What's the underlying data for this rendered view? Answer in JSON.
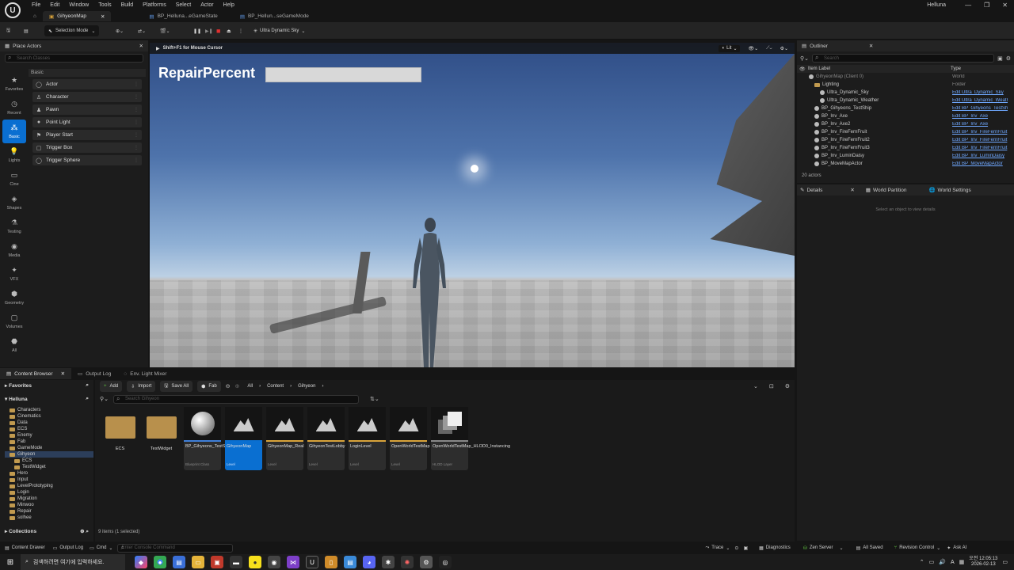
{
  "window": {
    "user": "Helluna",
    "controls": [
      "—",
      "❐",
      "✕"
    ]
  },
  "menu": [
    "File",
    "Edit",
    "Window",
    "Tools",
    "Build",
    "Platforms",
    "Select",
    "Actor",
    "Help"
  ],
  "tabs": [
    {
      "label": "GihyeonMap",
      "active": true
    },
    {
      "label": "BP_Helluna...eGameState",
      "active": false
    },
    {
      "label": "BP_Hellun...seGameMode",
      "active": false
    }
  ],
  "toolbar": {
    "mode": "Selection Mode",
    "sky": "Ultra Dynamic Sky"
  },
  "place_actors": {
    "title": "Place Actors",
    "search_placeholder": "Search Classes",
    "section": "Basic",
    "categories": [
      "Favorites",
      "Recent",
      "Basic",
      "Lights",
      "Cine",
      "Shapes",
      "Testing",
      "Media",
      "VFX",
      "Geometry",
      "Volumes",
      "All"
    ],
    "items": [
      "Actor",
      "Character",
      "Pawn",
      "Point Light",
      "Player Start",
      "Trigger Box",
      "Trigger Sphere"
    ]
  },
  "viewport": {
    "hint": "Shift+F1 for Mouse Cursor",
    "lit": "Lit",
    "overlay_text": "RepairPercent",
    "repair_percent": 0
  },
  "outliner": {
    "title": "Outliner",
    "search_placeholder": "Search",
    "col_label": "Item Label",
    "col_type": "Type",
    "rows": [
      {
        "label": "GihyeonMap (Client 0)",
        "type": "World",
        "indent": 1,
        "link": false
      },
      {
        "label": "Lighting",
        "type": "Folder",
        "indent": 2,
        "link": false
      },
      {
        "label": "Ultra_Dynamic_Sky",
        "type": "Edit Ultra_Dynamic_Sky",
        "indent": 3,
        "link": true
      },
      {
        "label": "Ultra_Dynamic_Weather",
        "type": "Edit Ultra_Dynamic_Weather",
        "indent": 3,
        "link": true
      },
      {
        "label": "BP_Gihyeons_TestShip",
        "type": "Edit BP_Gihyeons_TestShip",
        "indent": 2,
        "link": true
      },
      {
        "label": "BP_Inv_Axe",
        "type": "Edit BP_Inv_Axe",
        "indent": 2,
        "link": true
      },
      {
        "label": "BP_Inv_Axe2",
        "type": "Edit BP_Inv_Axe",
        "indent": 2,
        "link": true
      },
      {
        "label": "BP_Inv_FireFernFruit",
        "type": "Edit BP_Inv_FireFernFruit",
        "indent": 2,
        "link": true
      },
      {
        "label": "BP_Inv_FireFernFruit2",
        "type": "Edit BP_Inv_FireFernFruit",
        "indent": 2,
        "link": true
      },
      {
        "label": "BP_Inv_FireFernFruit3",
        "type": "Edit BP_Inv_FireFernFruit",
        "indent": 2,
        "link": true
      },
      {
        "label": "BP_Inv_LuminDaisy",
        "type": "Edit BP_Inv_LuminDaisy",
        "indent": 2,
        "link": true
      },
      {
        "label": "BP_MoveMapActor",
        "type": "Edit BP_MoveMapActor",
        "indent": 2,
        "link": true
      }
    ],
    "count": "20 actors"
  },
  "details": {
    "tabs": [
      "Details",
      "World Partition",
      "World Settings"
    ],
    "empty": "Select an object to view details"
  },
  "bottom_tabs": [
    "Content Browser",
    "Output Log",
    "Env. Light Mixer"
  ],
  "content_browser": {
    "favorites": "Favorites",
    "root": "Helluna",
    "tree": [
      {
        "label": "Characters",
        "indent": 1
      },
      {
        "label": "Cinematics",
        "indent": 1
      },
      {
        "label": "Data",
        "indent": 1
      },
      {
        "label": "ECS",
        "indent": 1
      },
      {
        "label": "Enemy",
        "indent": 1
      },
      {
        "label": "Fab",
        "indent": 1
      },
      {
        "label": "GameMode",
        "indent": 1
      },
      {
        "label": "Gihyeon",
        "indent": 1,
        "selected": true
      },
      {
        "label": "ECS",
        "indent": 2
      },
      {
        "label": "TestWidget",
        "indent": 2
      },
      {
        "label": "Hero",
        "indent": 1
      },
      {
        "label": "Input",
        "indent": 1
      },
      {
        "label": "LevelPrototyping",
        "indent": 1
      },
      {
        "label": "Login",
        "indent": 1
      },
      {
        "label": "Migration",
        "indent": 1
      },
      {
        "label": "Minwoo",
        "indent": 1
      },
      {
        "label": "Repair",
        "indent": 1
      },
      {
        "label": "solhee",
        "indent": 1
      }
    ],
    "collections": "Collections",
    "add": "Add",
    "import": "Import",
    "save_all": "Save All",
    "fab": "Fab",
    "path": [
      "All",
      "Content",
      "Gihyeon"
    ],
    "search_placeholder": "Search Gihyeon",
    "assets": [
      {
        "name": "ECS",
        "type": "",
        "kind": "folder"
      },
      {
        "name": "TestWidget",
        "type": "",
        "kind": "folder"
      },
      {
        "name": "BP_Gihyeons_TestShip",
        "type": "Blueprint Class",
        "kind": "sphere"
      },
      {
        "name": "GihyeonMap",
        "type": "Level",
        "kind": "level",
        "selected": true
      },
      {
        "name": "GihyeonMap_Real",
        "type": "Level",
        "kind": "level"
      },
      {
        "name": "GihyeonTestLobby",
        "type": "Level",
        "kind": "level"
      },
      {
        "name": "LoginLevel",
        "type": "Level",
        "kind": "level"
      },
      {
        "name": "OpenWorldTestMap",
        "type": "Level",
        "kind": "level"
      },
      {
        "name": "OpenWorldTestMap_HLOD0_Instancing",
        "type": "HLOD Layer",
        "kind": "hlod"
      }
    ],
    "status": "9 items (1 selected)"
  },
  "statusbar": {
    "content_drawer": "Content Drawer",
    "output_log": "Output Log",
    "cmd": "Cmd",
    "cmd_placeholder": "Enter Console Command",
    "trace": "Trace",
    "diagnostics": "Diagnostics",
    "zen": "Zen Server",
    "saved": "All Saved",
    "revision": "Revision Control",
    "ask": "Ask AI"
  },
  "taskbar": {
    "search_placeholder": "검색하려면 여기에 입력하세요.",
    "time": "오전 12:05:13",
    "date": "2026-02-13",
    "lang": "A"
  }
}
